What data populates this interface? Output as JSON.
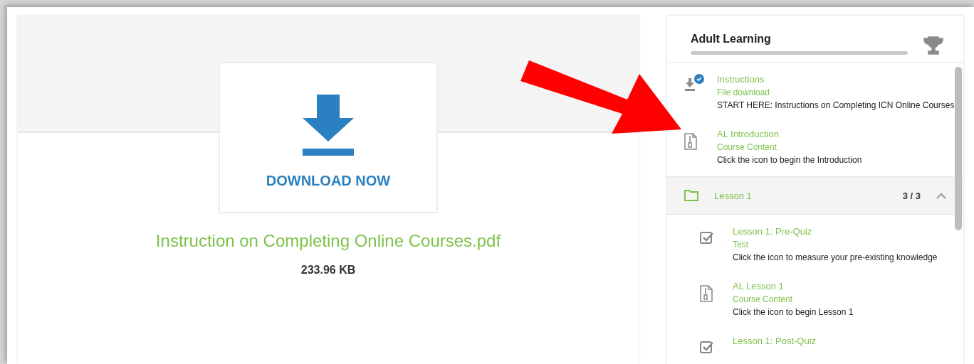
{
  "file_viewer": {
    "button_label": "DOWNLOAD NOW",
    "file_name": "Instruction on Completing Online Courses.pdf",
    "file_size": "233.96 KB"
  },
  "course": {
    "title": "Adult Learning",
    "progress": {
      "level": 0
    },
    "items": [
      {
        "kind": "download",
        "title": "Instructions",
        "type": "File download",
        "description": "START HERE: Instructions on Completing ICN Online Courses",
        "completed": true
      },
      {
        "kind": "content",
        "title": "AL Introduction",
        "type": "Course Content",
        "description": "Click the icon to begin the Introduction",
        "completed": false
      }
    ],
    "sections": [
      {
        "title": "Lesson 1",
        "count": "3 / 3",
        "expanded": true,
        "items": [
          {
            "kind": "test",
            "title": "Lesson 1: Pre-Quiz",
            "type": "Test",
            "description": "Click the icon to measure your pre-existing knowledge",
            "completed": false
          },
          {
            "kind": "content",
            "title": "AL Lesson 1",
            "type": "Course Content",
            "description": "Click the icon to begin Lesson 1",
            "completed": false
          },
          {
            "kind": "test",
            "title": "Lesson 1: Post-Quiz",
            "completed": false
          }
        ]
      }
    ]
  }
}
